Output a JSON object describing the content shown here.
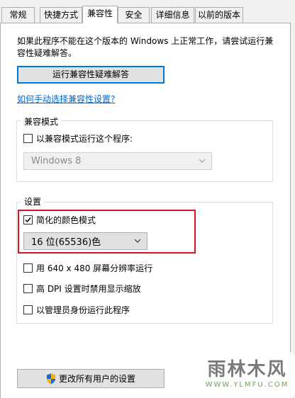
{
  "tabs": [
    {
      "label": "常规"
    },
    {
      "label": "快捷方式"
    },
    {
      "label": "兼容性"
    },
    {
      "label": "安全"
    },
    {
      "label": "详细信息"
    },
    {
      "label": "以前的版本"
    }
  ],
  "compat": {
    "intro_text": "如果此程序不能在这个版本的 Windows 上正常工作，请尝试运行兼容性疑难解答。",
    "troubleshoot_button": "运行兼容性疑难解答",
    "manual_link": "如何手动选择兼容性设置?",
    "mode_group": {
      "title": "兼容模式",
      "checkbox_label": "以兼容模式运行这个程序:",
      "checked": false,
      "os_select_value": "Windows 8"
    },
    "settings_group": {
      "title": "设置",
      "reduced_color": {
        "label": "简化的颜色模式",
        "checked": true
      },
      "color_select_value": "16 位(65536)色",
      "res640": {
        "label": "用 640 x 480 屏幕分辨率运行",
        "checked": false
      },
      "high_dpi": {
        "label": "高 DPI 设置时禁用显示缩放",
        "checked": false
      },
      "admin": {
        "label": "以管理员身份运行此程序",
        "checked": false
      }
    },
    "all_users_button": "更改所有用户的设置"
  },
  "watermark": {
    "brand": "雨林木风",
    "url": "WWW.YLMFU.COM"
  },
  "colors": {
    "accent": "#0078d7",
    "highlight": "#d9131f",
    "link": "#0066cc"
  },
  "icons": {
    "shield": "uac-shield-icon",
    "check": "checkmark",
    "dropdown": "chevron-down-icon"
  }
}
